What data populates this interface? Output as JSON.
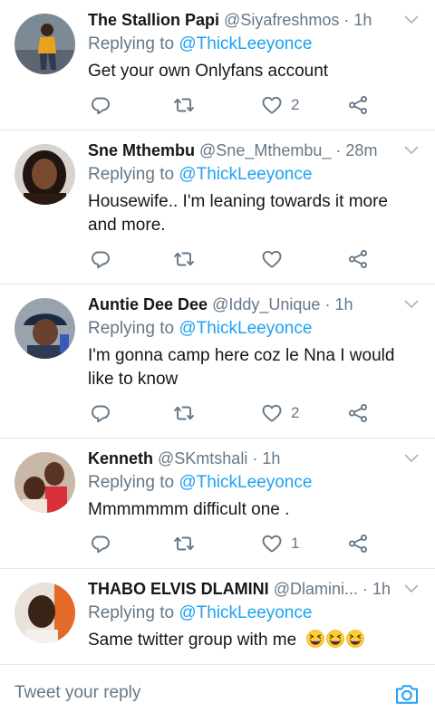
{
  "compose": {
    "placeholder": "Tweet your reply",
    "camera_icon": "camera-icon"
  },
  "colors": {
    "link": "#1da1f2",
    "secondary_text": "#657786",
    "divider": "#e1e8ed"
  },
  "tweets": [
    {
      "name": "The Stallion Papi",
      "handle": "@Siyafreshmos",
      "sep": "·",
      "time": "1h",
      "replying_prefix": "Replying to",
      "replying_to": "@ThickLeeyonce",
      "text": "Get your own Onlyfans account",
      "likes": "2"
    },
    {
      "name": "Sne Mthembu",
      "handle": "@Sne_Mthembu_",
      "sep": "·",
      "time": "28m",
      "replying_prefix": "Replying to",
      "replying_to": "@ThickLeeyonce",
      "text": "Housewife.. I'm leaning towards it more and more.",
      "likes": ""
    },
    {
      "name": "Auntie Dee Dee",
      "handle": "@Iddy_Unique",
      "sep": "·",
      "time": "1h",
      "replying_prefix": "Replying to",
      "replying_to": "@ThickLeeyonce",
      "text": "I'm gonna camp here coz le Nna I would like to know",
      "likes": "2"
    },
    {
      "name": "Kenneth",
      "handle": "@SKmtshali",
      "sep": "·",
      "time": "1h",
      "replying_prefix": "Replying to",
      "replying_to": "@ThickLeeyonce",
      "text": "Mmmmmmm difficult one .",
      "likes": "1"
    },
    {
      "name": "THABO ELVIS DLAMINI",
      "handle": "@Dlamini...",
      "sep": "·",
      "time": "1h",
      "replying_prefix": "Replying to",
      "replying_to": "@ThickLeeyonce",
      "text": "Same twitter group with me",
      "emoji": [
        "grinning-squinting-face",
        "grinning-squinting-face",
        "grinning-squinting-face"
      ],
      "likes": ""
    }
  ]
}
